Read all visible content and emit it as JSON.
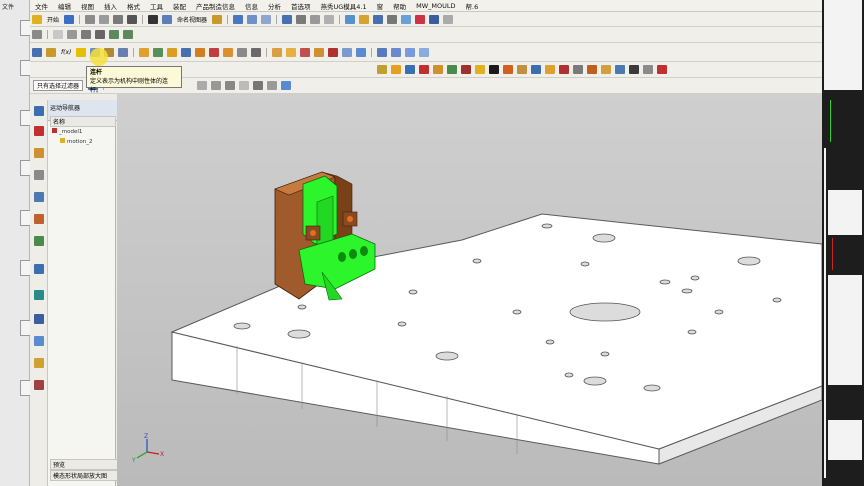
{
  "menubar": {
    "items": [
      "文件",
      "编辑",
      "视图",
      "插入",
      "格式",
      "工具",
      "装配",
      "产品制造信息",
      "信息",
      "分析",
      "首选项",
      "燕秀UG模具4.1",
      "窗",
      "帮助",
      "MW_MOULD",
      "帮.6"
    ]
  },
  "left_strip_label": "文件",
  "toolbar1": {
    "start_label": "开始",
    "named_view_label": "命名视图器"
  },
  "selection_bar": {
    "filter_label": "只有选择过滤器"
  },
  "tooltip": {
    "title": "连杆",
    "description": "定义表示为机构中刚性体的连杆。"
  },
  "navigator": {
    "title": "运动导航器",
    "column_name": "名称",
    "tree": [
      "_model1",
      "motion_2"
    ],
    "footer_preview": "预览",
    "footer_detail": "模态形状局部放大图"
  },
  "colors": {
    "frame_green": "#2cf52c",
    "frame_brown": "#a05a2c",
    "plate_face": "#ffffff",
    "plate_edge": "#5a5a5a",
    "tooltip_bg": "#fbf9d7"
  }
}
